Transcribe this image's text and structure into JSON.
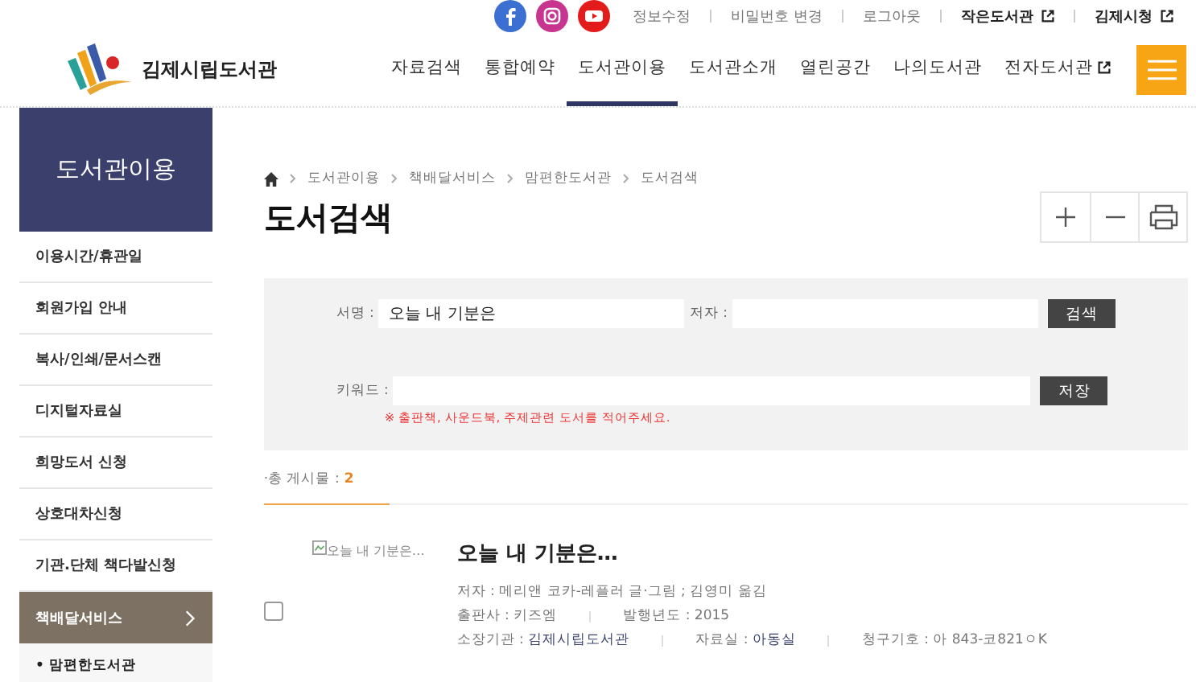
{
  "header": {
    "util_links": [
      {
        "label": "정보수정",
        "external": false
      },
      {
        "label": "비밀번호 변경",
        "external": false
      },
      {
        "label": "로그아웃",
        "external": false
      },
      {
        "label": "작은도서관",
        "external": true
      },
      {
        "label": "김제시청",
        "external": true
      }
    ],
    "logo": "김제시립도서관",
    "nav": [
      {
        "label": "자료검색",
        "selected": false,
        "external": false
      },
      {
        "label": "통합예약",
        "selected": false,
        "external": false
      },
      {
        "label": "도서관이용",
        "selected": true,
        "external": false
      },
      {
        "label": "도서관소개",
        "selected": false,
        "external": false
      },
      {
        "label": "열린공간",
        "selected": false,
        "external": false
      },
      {
        "label": "나의도서관",
        "selected": false,
        "external": false
      },
      {
        "label": "전자도서관",
        "selected": false,
        "external": true
      }
    ]
  },
  "sidebar": {
    "title": "도서관이용",
    "items": [
      {
        "label": "이용시간/휴관일",
        "selected": false
      },
      {
        "label": "회원가입 안내",
        "selected": false
      },
      {
        "label": "복사/인쇄/문서스캔",
        "selected": false
      },
      {
        "label": "디지털자료실",
        "selected": false
      },
      {
        "label": "희망도서 신청",
        "selected": false
      },
      {
        "label": "상호대차신청",
        "selected": false
      },
      {
        "label": "기관.단체 책다발신청",
        "selected": false
      },
      {
        "label": "책배달서비스",
        "selected": true,
        "children": [
          {
            "label": "• 맘편한도서관"
          }
        ]
      }
    ]
  },
  "breadcrumb": [
    "도서관이용",
    "책배달서비스",
    "맘편한도서관",
    "도서검색"
  ],
  "page_title": "도서검색",
  "search_form": {
    "title_label": "서명 :",
    "title_value": "오늘 내 기분은",
    "author_label": "저자 :",
    "search_button": "검색",
    "keyword_label": "키워드 :",
    "save_button": "저장",
    "hint": "※ 출판책, 사운드북, 주제관련 도서를 적어주세요."
  },
  "results": {
    "total_label": "·총 게시물 :",
    "total_count": "2",
    "books": [
      {
        "image_alt": "오늘 내 기분은…",
        "title": "오늘 내 기분은…",
        "checked": false,
        "lines": [
          [
            {
              "label": "저자 :",
              "value": "메리앤 코카-레플러 글·그림 ; 김영미 옮김",
              "link": false
            }
          ],
          [
            {
              "label": "출판사 :",
              "value": "키즈엠",
              "link": false
            },
            {
              "label": "발행년도 :",
              "value": "2015",
              "link": false
            }
          ],
          [
            {
              "label": "소장기관 :",
              "value": "김제시립도서관",
              "link": true
            },
            {
              "label": "자료실 :",
              "value": "아동실",
              "link": true
            },
            {
              "label": "청구기호 :",
              "value": "아 843-코821ㅇK",
              "link": false
            }
          ]
        ]
      }
    ]
  }
}
